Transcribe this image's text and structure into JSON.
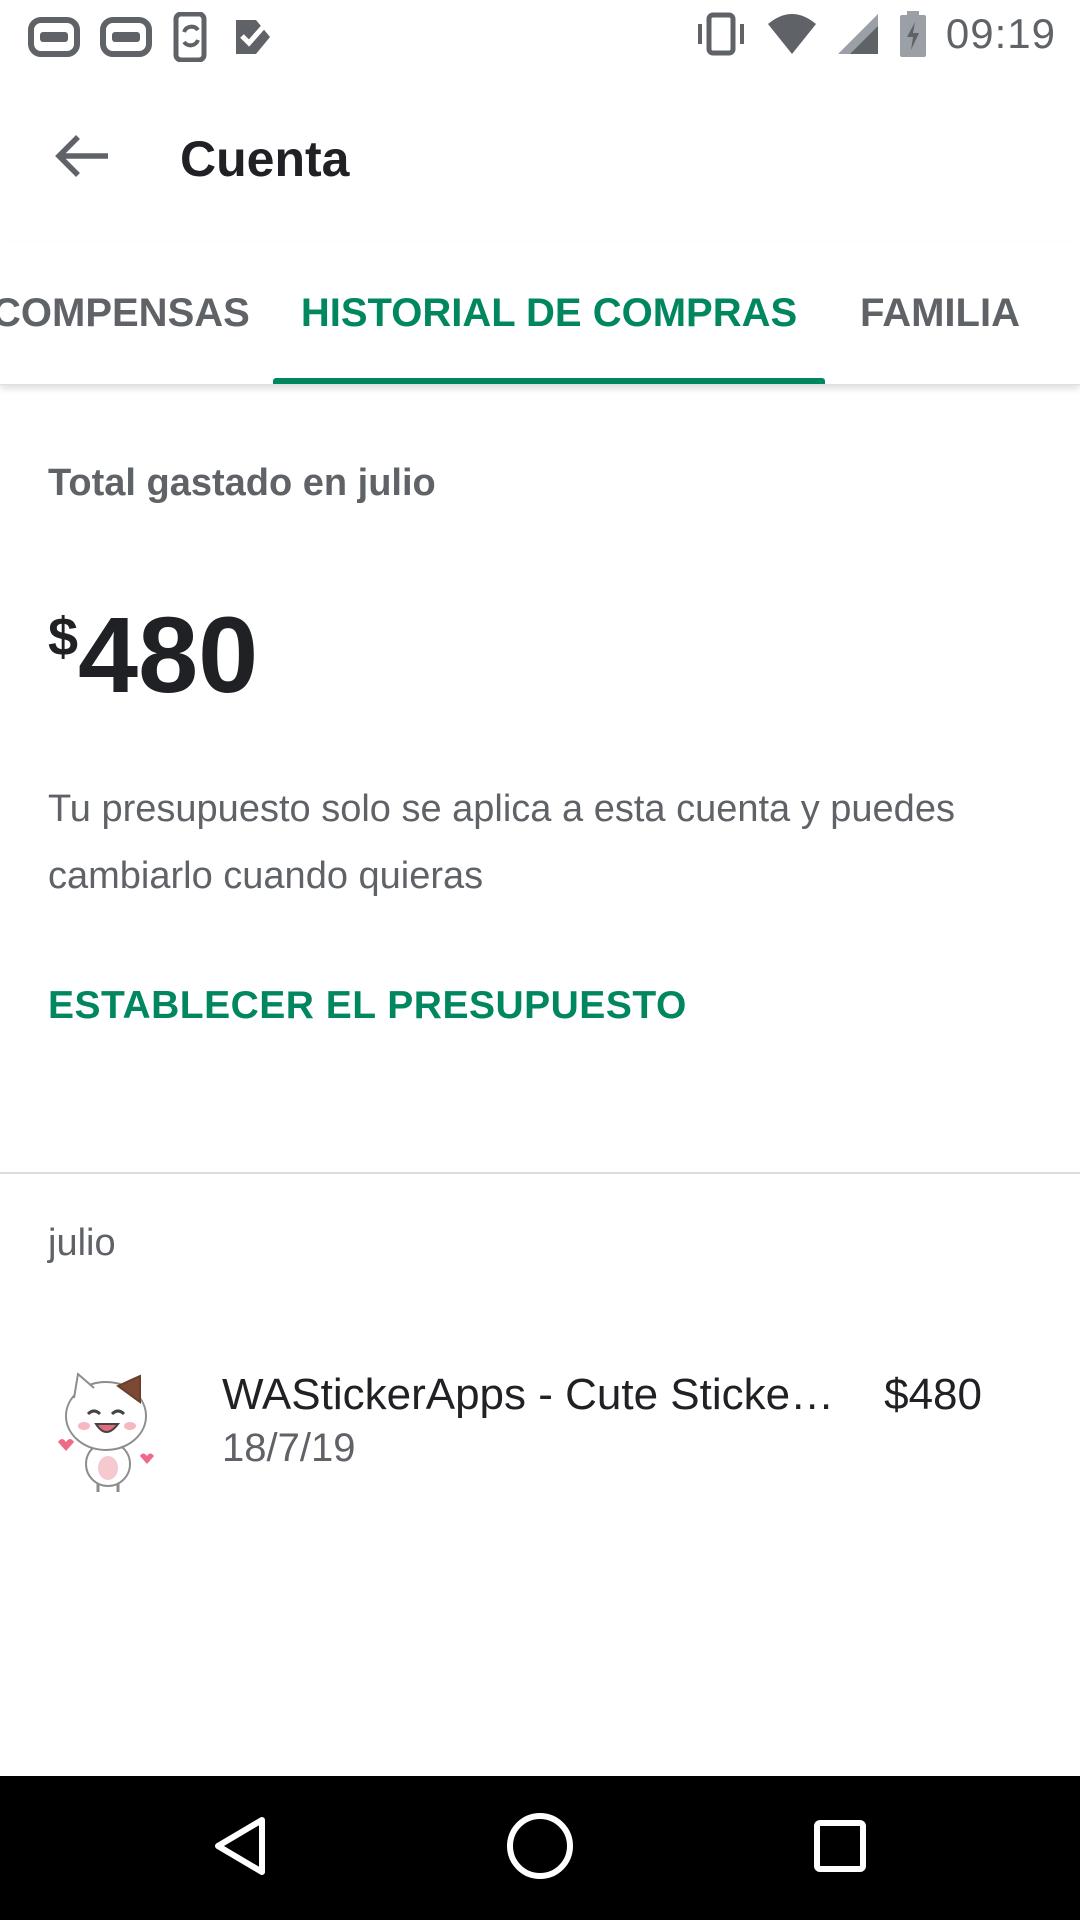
{
  "status_bar": {
    "time": "09:19",
    "left_icons": [
      "notification-icon-1",
      "notification-icon-2",
      "phone-sync-icon",
      "task-check-icon"
    ],
    "right_icons": [
      "vibrate-icon",
      "wifi-icon",
      "signal-icon",
      "battery-charging-icon"
    ]
  },
  "app_bar": {
    "title": "Cuenta",
    "back_icon": "arrow-back-icon"
  },
  "tabs": [
    {
      "label": "COMPENSAS",
      "selected": false
    },
    {
      "label": "HISTORIAL DE COMPRAS",
      "selected": true
    },
    {
      "label": "FAMILIA",
      "selected": false
    }
  ],
  "budget": {
    "label": "Total gastado en julio",
    "currency": "$",
    "amount": "480",
    "description": "Tu presupuesto solo se aplica a esta cuenta y puedes cambiarlo cuando quieras",
    "action_label": "ESTABLECER EL PRESUPUESTO"
  },
  "history": {
    "month": "julio",
    "items": [
      {
        "title": "WAStickerApps - Cute Sticke…",
        "price": "$480",
        "date": "18/7/19",
        "icon": "cat-sticker-icon"
      }
    ]
  },
  "colors": {
    "accent": "#01875f",
    "secondary_text": "#5f6368",
    "primary_text": "#202124",
    "nav_bar": "#000000"
  }
}
